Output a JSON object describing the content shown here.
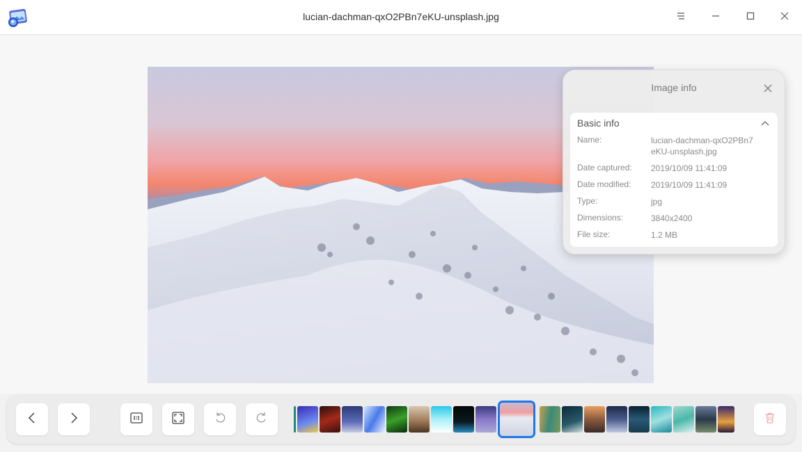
{
  "window": {
    "title": "lucian-dachman-qxO2PBn7eKU-unsplash.jpg"
  },
  "icons": {
    "app": "image-viewer-app-icon",
    "menu": "menu-icon",
    "minimize": "minimize-icon",
    "maximize": "maximize-icon",
    "close": "close-icon"
  },
  "info_panel": {
    "title": "Image info",
    "section_title": "Basic info",
    "rows": [
      {
        "key": "Name:",
        "value": "lucian-dachman-qxO2PBn7eKU-unsplash.jpg"
      },
      {
        "key": "Date captured:",
        "value": "2019/10/09 11:41:09"
      },
      {
        "key": "Date modified:",
        "value": "2019/10/09 11:41:09"
      },
      {
        "key": "Type:",
        "value": "jpg"
      },
      {
        "key": "Dimensions:",
        "value": "3840x2400"
      },
      {
        "key": "File size:",
        "value": "1.2 MB"
      }
    ]
  },
  "toolbar": {
    "buttons": [
      "previous-icon",
      "next-icon",
      "original-size-icon",
      "fit-window-icon",
      "rotate-left-icon",
      "rotate-right-icon",
      "delete-icon"
    ],
    "accent_color": "#1e77e8",
    "delete_color": "#f2a3a8"
  },
  "thumbnails": {
    "count": 21,
    "active_index": 9
  }
}
